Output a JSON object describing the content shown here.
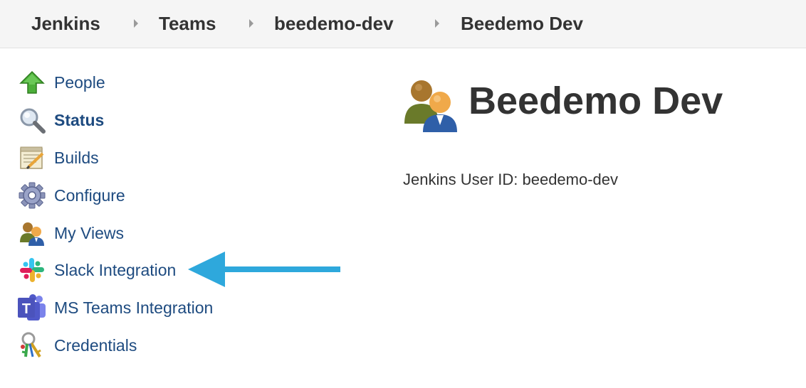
{
  "breadcrumb": {
    "items": [
      "Jenkins",
      "Teams",
      "beedemo-dev",
      "Beedemo Dev"
    ]
  },
  "sidebar": {
    "items": [
      {
        "label": "People",
        "icon": "up-arrow-icon"
      },
      {
        "label": "Status",
        "icon": "magnifier-icon",
        "active": true
      },
      {
        "label": "Builds",
        "icon": "notepad-icon"
      },
      {
        "label": "Configure",
        "icon": "gear-icon"
      },
      {
        "label": "My Views",
        "icon": "users-icon"
      },
      {
        "label": "Slack Integration",
        "icon": "slack-icon"
      },
      {
        "label": "MS Teams Integration",
        "icon": "ms-teams-icon"
      },
      {
        "label": "Credentials",
        "icon": "keys-icon"
      }
    ]
  },
  "main": {
    "title": "Beedemo Dev",
    "user_id_text": "Jenkins User ID: beedemo-dev"
  },
  "colors": {
    "link": "#1e4b80",
    "annotation_arrow": "#2ea8dc",
    "breadcrumb_bg": "#f5f5f5"
  }
}
